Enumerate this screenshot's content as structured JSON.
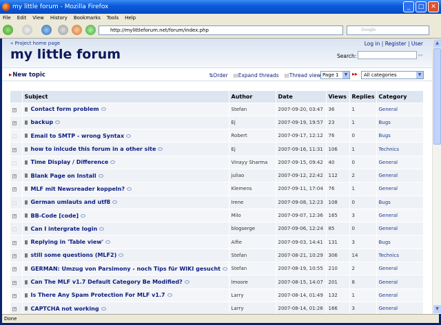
{
  "window": {
    "title": "my little forum - Mozilla Firefox"
  },
  "menu": [
    "File",
    "Edit",
    "View",
    "History",
    "Bookmarks",
    "Tools",
    "Help"
  ],
  "nav": {
    "url": "http://mylittleforum.net/forum/index.php",
    "search_placeholder": "Google"
  },
  "header": {
    "home_link": "« Project home page",
    "title": "my little forum",
    "login": "Log in",
    "register": "Register",
    "user": "User",
    "sep": "|",
    "search_label": "Search:"
  },
  "toolbar": {
    "new_topic": "New topic",
    "order": "Order",
    "expand": "Expand threads",
    "thread_view": "Thread view",
    "page": "Page 1",
    "category": "All categories"
  },
  "table": {
    "headers": [
      "Subject",
      "Author",
      "Date",
      "Views",
      "Replies",
      "Category"
    ],
    "rows": [
      {
        "expand": true,
        "subject": "Contact form problem",
        "author": "Stefan",
        "date": "2007-09-20, 03:47",
        "views": "36",
        "replies": "1",
        "category": "General"
      },
      {
        "expand": true,
        "subject": "backup",
        "author": "Ej",
        "date": "2007-09-19, 19:57",
        "views": "23",
        "replies": "1",
        "category": "Bugs"
      },
      {
        "expand": false,
        "subject": "Email to SMTP - wrong Syntax",
        "author": "Robert",
        "date": "2007-09-17, 12:12",
        "views": "76",
        "replies": "0",
        "category": "Bugs"
      },
      {
        "expand": true,
        "subject": "how to inlcude this forum in a other site",
        "author": "Ej",
        "date": "2007-09-16, 11:31",
        "views": "106",
        "replies": "1",
        "category": "Technics"
      },
      {
        "expand": false,
        "subject": "Time Display / Difference",
        "author": "Vinayy Sharma",
        "date": "2007-09-15, 09:42",
        "views": "40",
        "replies": "0",
        "category": "General"
      },
      {
        "expand": true,
        "subject": "Blank Page on Install",
        "author": "juliao",
        "date": "2007-09-12, 22:42",
        "views": "112",
        "replies": "2",
        "category": "General"
      },
      {
        "expand": true,
        "subject": "MLF mit Newsreader koppeln?",
        "author": "Klemens",
        "date": "2007-09-11, 17:04",
        "views": "76",
        "replies": "1",
        "category": "General"
      },
      {
        "expand": false,
        "subject": "German umlauts and utf8",
        "author": "Irene",
        "date": "2007-09-08, 12:23",
        "views": "108",
        "replies": "0",
        "category": "Bugs"
      },
      {
        "expand": true,
        "subject": "BB-Code [code]",
        "author": "Milo",
        "date": "2007-09-07, 12:36",
        "views": "165",
        "replies": "3",
        "category": "General"
      },
      {
        "expand": false,
        "subject": "Can I intergrate login",
        "author": "blogserge",
        "date": "2007-09-06, 12:24",
        "views": "85",
        "replies": "0",
        "category": "General"
      },
      {
        "expand": true,
        "subject": "Replying in 'Table view'",
        "author": "Alfie",
        "date": "2007-09-03, 14:41",
        "views": "131",
        "replies": "3",
        "category": "Bugs"
      },
      {
        "expand": true,
        "subject": "still some questions (MLF2)",
        "author": "Stefan",
        "date": "2007-08-21, 10:29",
        "views": "306",
        "replies": "14",
        "category": "Technics"
      },
      {
        "expand": true,
        "subject": "GERMAN: Umzug von Parsimony - noch Tips für WIKI gesucht",
        "author": "Stefan",
        "date": "2007-08-19, 10:55",
        "views": "210",
        "replies": "2",
        "category": "General"
      },
      {
        "expand": true,
        "subject": "Can The MLF v1.7 Default Category Be Modified?",
        "author": "lmoore",
        "date": "2007-08-15, 14:07",
        "views": "201",
        "replies": "8",
        "category": "General"
      },
      {
        "expand": true,
        "subject": "Is There Any Spam Protection For MLF v1.7",
        "author": "Larry",
        "date": "2007-08-14, 01:49",
        "views": "132",
        "replies": "1",
        "category": "General"
      },
      {
        "expand": true,
        "subject": "CAPTCHA not working",
        "author": "Larry",
        "date": "2007-08-14, 01:26",
        "views": "166",
        "replies": "3",
        "category": "General"
      }
    ]
  },
  "status": "Done"
}
